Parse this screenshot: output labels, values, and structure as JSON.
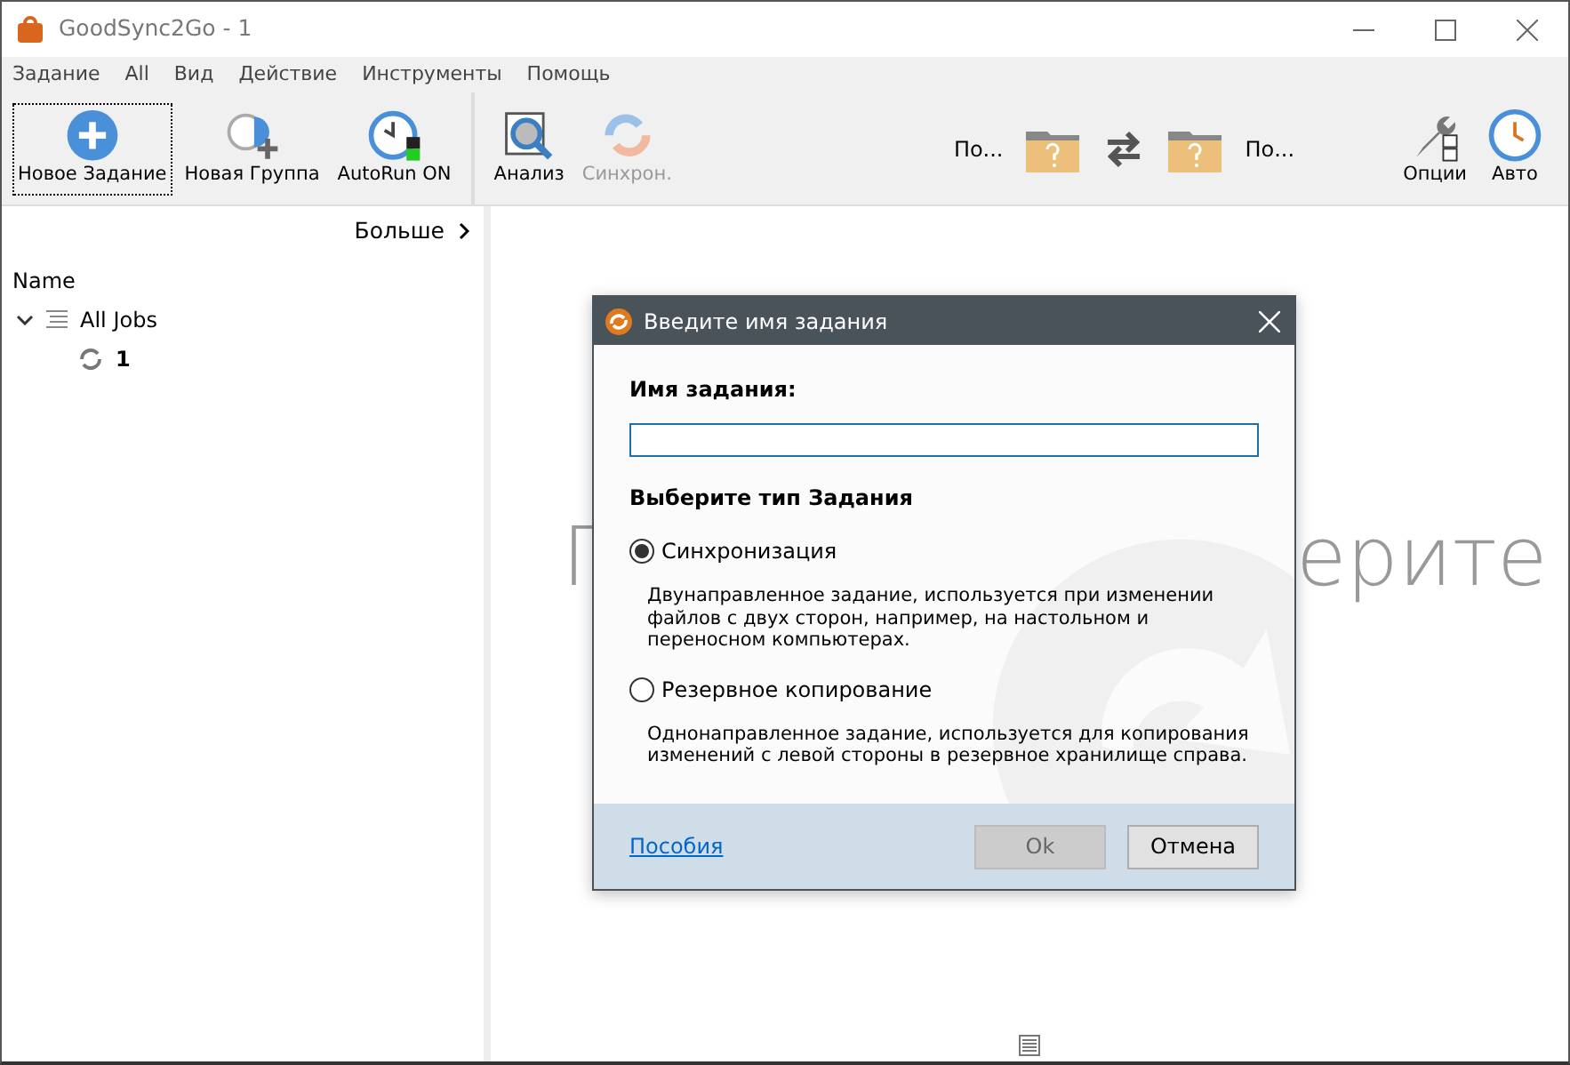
{
  "window": {
    "title": "GoodSync2Go - 1"
  },
  "menu": [
    "Задание",
    "All",
    "Вид",
    "Действие",
    "Инструменты",
    "Помощь"
  ],
  "toolbar_left": [
    {
      "kind": "add",
      "label": "Новое Задание",
      "focused": true,
      "disabled": false
    },
    {
      "kind": "group",
      "label": "Новая Группа",
      "focused": false,
      "disabled": false
    },
    {
      "kind": "autorun",
      "label": "AutoRun ON",
      "focused": false,
      "disabled": false
    }
  ],
  "toolbar_job": [
    {
      "kind": "analyze",
      "label": "Анализ",
      "focused": false,
      "disabled": false
    },
    {
      "kind": "sync",
      "label": "Синхрон.",
      "focused": false,
      "disabled": true
    }
  ],
  "folders": {
    "left": "По...",
    "right": "По..."
  },
  "toolbar_right": [
    {
      "kind": "options",
      "label": "Опции",
      "focused": false,
      "disabled": false
    },
    {
      "kind": "auto",
      "label": "Авто",
      "focused": false,
      "disabled": false
    }
  ],
  "sidebar": {
    "more": "Больше",
    "column": "Name",
    "tree": [
      {
        "label": "All Jobs",
        "expanded": true,
        "children": [
          {
            "label": "1"
          }
        ]
      }
    ]
  },
  "background_text": [
    "Г",
    "ерите"
  ],
  "dialog": {
    "title": "Введите имя задания",
    "name_label": "Имя задания:",
    "type_label": "Выберите тип Задания",
    "options": [
      {
        "label": "Синхронизация",
        "selected": true,
        "description": "Двунаправленное задание, используется при изменении файлов с двух сторон, например, на настольном и переносном компьютерах."
      },
      {
        "label": "Резервное копирование",
        "selected": false,
        "description": "Однонаправленное задание, используется для копирования изменений с левой стороны в резервное хранилище справа."
      }
    ],
    "help_link": "Пособия",
    "buttons": [
      {
        "label": "Ok",
        "disabled": true
      },
      {
        "label": "Отмена",
        "disabled": false
      }
    ]
  }
}
